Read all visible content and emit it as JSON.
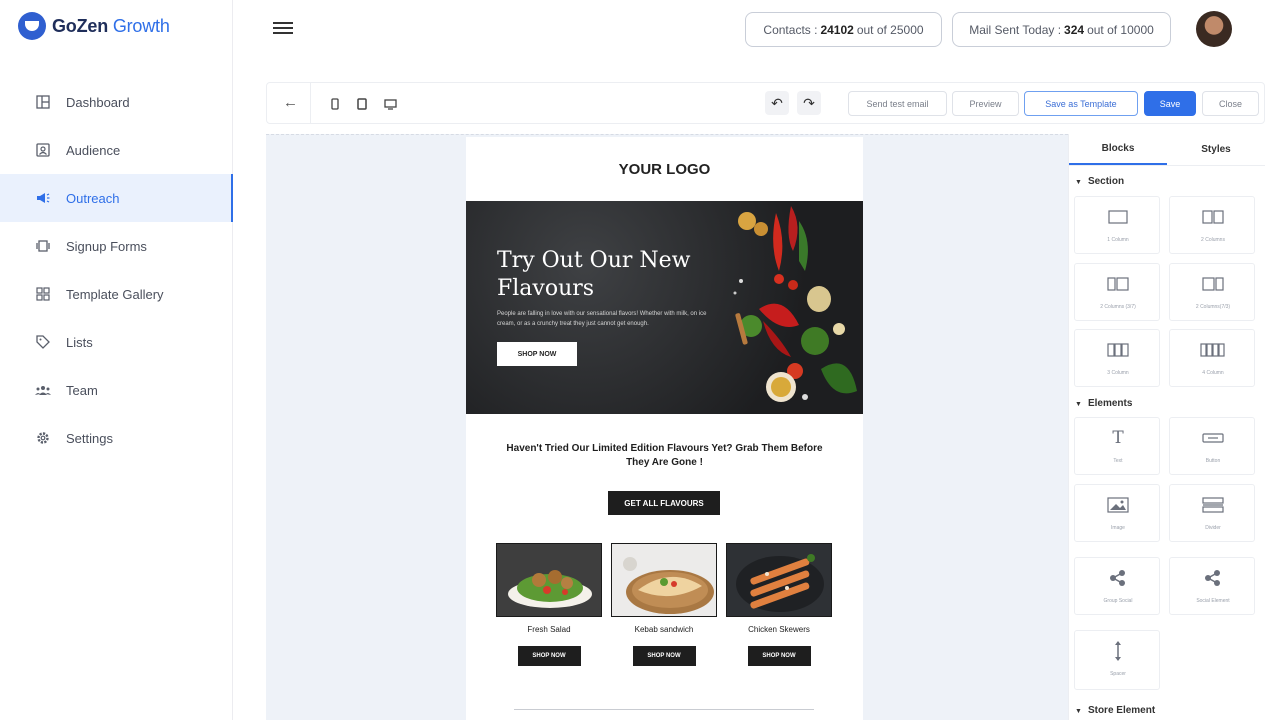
{
  "brand": {
    "name_part1": "GoZen",
    "name_part2": "Growth"
  },
  "sidebar": {
    "items": [
      {
        "label": "Dashboard",
        "icon": "layout-icon"
      },
      {
        "label": "Audience",
        "icon": "contacts-icon"
      },
      {
        "label": "Outreach",
        "icon": "megaphone-icon",
        "active": true
      },
      {
        "label": "Signup Forms",
        "icon": "form-icon"
      },
      {
        "label": "Template Gallery",
        "icon": "grid-icon"
      },
      {
        "label": "Lists",
        "icon": "tag-icon"
      },
      {
        "label": "Team",
        "icon": "team-icon"
      },
      {
        "label": "Settings",
        "icon": "gear-icon"
      }
    ]
  },
  "header": {
    "contacts_label": "Contacts :",
    "contacts_value": "24102",
    "contacts_suffix": "out of 25000",
    "mail_label": "Mail Sent Today :",
    "mail_value": "324",
    "mail_suffix": "out of 10000"
  },
  "toolbar": {
    "send_test": "Send test email",
    "preview": "Preview",
    "save_template": "Save as Template",
    "save": "Save",
    "close": "Close"
  },
  "email": {
    "logo": "YOUR LOGO",
    "hero_title": "Try Out Our New Flavours",
    "hero_text": "People are falling in love with our sensational flavors! Whether with milk, on ice cream, or as a crunchy treat they just cannot get enough.",
    "hero_cta": "SHOP NOW",
    "headline": "Haven't Tried Our Limited Edition Flavours Yet? Grab Them Before They Are Gone !",
    "cta": "GET ALL FLAVOURS",
    "products": [
      {
        "name": "Fresh Salad",
        "button": "SHOP NOW"
      },
      {
        "name": "Kebab sandwich",
        "button": "SHOP NOW"
      },
      {
        "name": "Chicken Skewers",
        "button": "SHOP NOW"
      }
    ]
  },
  "panel": {
    "tabs": [
      "Blocks",
      "Styles"
    ],
    "section_title": "Section",
    "section_blocks": [
      "1 Column",
      "2 Columns",
      "2 Columns (3/7)",
      "2 Columns(7/3)",
      "3 Column",
      "4 Column"
    ],
    "elements_title": "Elements",
    "element_blocks": [
      "Text",
      "Button",
      "Image",
      "Divider",
      "Group Social",
      "Social Element",
      "Spacer"
    ],
    "store_title": "Store Element"
  },
  "colors": {
    "accent": "#2f6fe8",
    "brand_dark": "#1f2e5a",
    "active_bg": "#eaf1fd"
  }
}
